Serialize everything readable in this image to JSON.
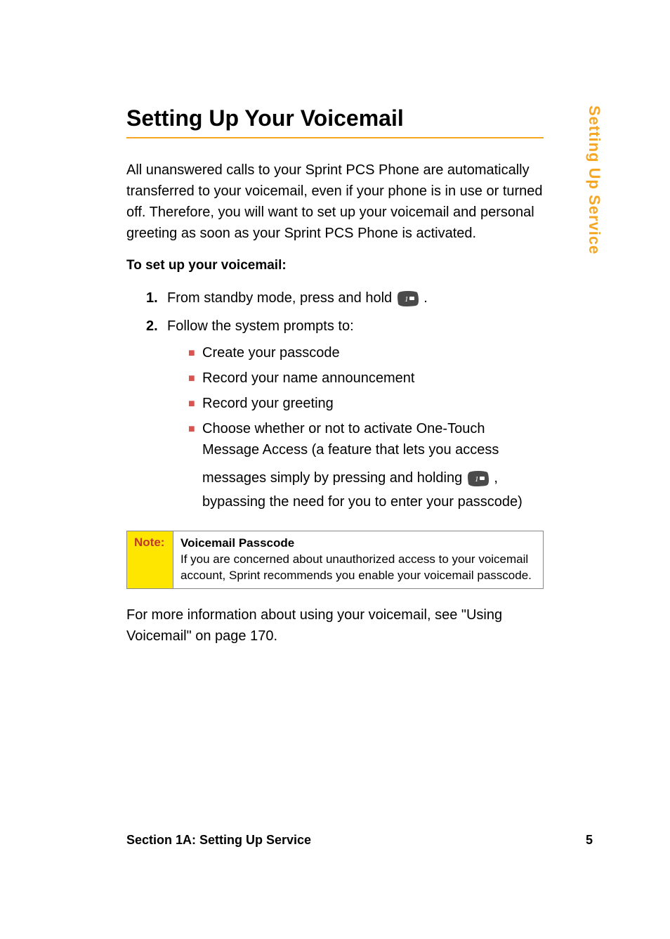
{
  "heading": "Setting Up Your Voicemail",
  "intro": "All unanswered calls to your Sprint PCS Phone are automatically transferred to your voicemail, even if your phone is in use or turned off. Therefore, you will want to set up your voicemail and personal greeting as soon as your Sprint PCS Phone is activated.",
  "subhead": "To set up your voicemail:",
  "steps": [
    {
      "marker": "1.",
      "pre": "From standby mode, press and hold ",
      "post": "."
    },
    {
      "marker": "2.",
      "text": "Follow the system prompts to:"
    }
  ],
  "bullets": [
    "Create your passcode",
    "Record your name announcement",
    "Record your greeting"
  ],
  "bullet4_line1": "Choose whether or not to activate One-Touch Message Access (a feature that lets you access",
  "bullet4_pre": "messages simply by pressing and holding ",
  "bullet4_post": ", bypassing the need for you to enter your passcode)",
  "note": {
    "label": "Note:",
    "title": "Voicemail Passcode",
    "body": "If you are concerned about unauthorized access to your voicemail account, Sprint recommends you enable your voicemail passcode."
  },
  "closing": "For more information about using your voicemail, see \"Using Voicemail\" on page 170.",
  "footer_left": "Section 1A: Setting Up Service",
  "footer_right": "5",
  "side_tab": "Setting Up Service"
}
